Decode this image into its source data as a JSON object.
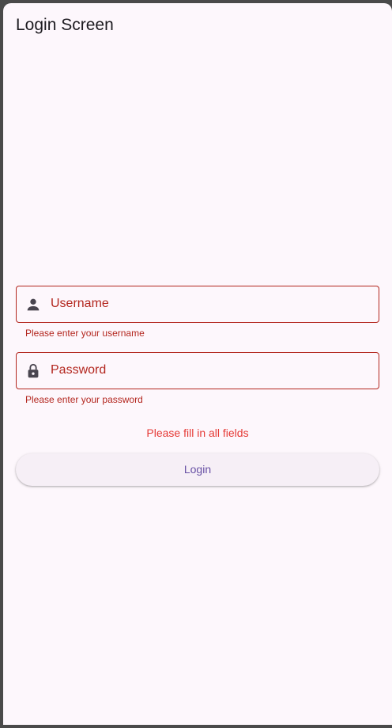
{
  "app_bar": {
    "title": "Login Screen"
  },
  "form": {
    "username": {
      "label": "Username",
      "value": "",
      "error": "Please enter your username",
      "icon": "person-icon"
    },
    "password": {
      "label": "Password",
      "value": "",
      "error": "Please enter your password",
      "icon": "lock-icon"
    },
    "form_error": "Please fill in all fields",
    "login_label": "Login"
  },
  "colors": {
    "error": "#b3261e",
    "form_error": "#e53935",
    "primary": "#6750a4",
    "background": "#fdf7fc",
    "icon": "#49454f"
  }
}
